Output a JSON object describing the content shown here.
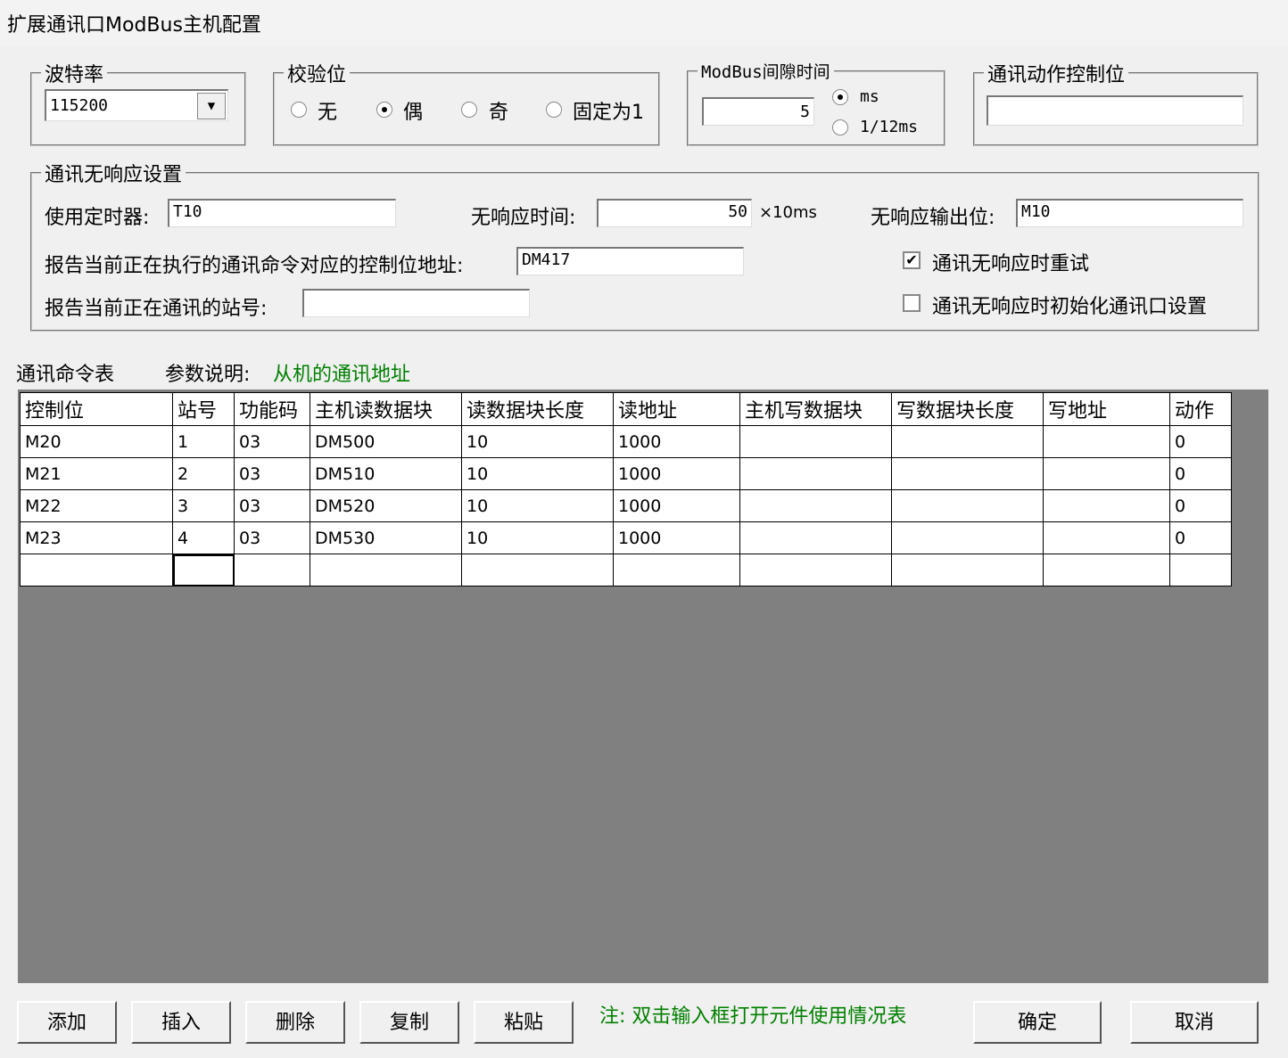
{
  "window": {
    "title": "扩展通讯口ModBus主机配置"
  },
  "baud": {
    "legend": "波特率",
    "value": "115200"
  },
  "parity": {
    "legend": "校验位",
    "options": [
      {
        "label": "无",
        "selected": false
      },
      {
        "label": "偶",
        "selected": true
      },
      {
        "label": "奇",
        "selected": false
      },
      {
        "label": "固定为1",
        "selected": false
      }
    ]
  },
  "gap": {
    "legend": "ModBus间隙时间",
    "value": "5",
    "units": [
      {
        "label": "ms",
        "selected": true
      },
      {
        "label": "1/12ms",
        "selected": false
      }
    ]
  },
  "action_ctrl": {
    "legend": "通讯动作控制位",
    "value": ""
  },
  "noresp": {
    "legend": "通讯无响应设置",
    "timer_label": "使用定时器:",
    "timer_value": "T10",
    "time_label": "无响应时间:",
    "time_value": "50",
    "time_unit": "×10ms",
    "out_label": "无响应输出位:",
    "out_value": "M10",
    "report_ctrl_label": "报告当前正在执行的通讯命令对应的控制位地址:",
    "report_ctrl_value": "DM417",
    "report_station_label": "报告当前正在通讯的站号:",
    "report_station_value": "",
    "retry_label": "通讯无响应时重试",
    "retry_checked": true,
    "reinit_label": "通讯无响应时初始化通讯口设置",
    "reinit_checked": false
  },
  "cmd": {
    "title": "通讯命令表",
    "param_label": "参数说明:",
    "param_value": "从机的通讯地址",
    "columns": [
      "控制位",
      "站号",
      "功能码",
      "主机读数据块",
      "读数据块长度",
      "读地址",
      "主机写数据块",
      "写数据块长度",
      "写地址",
      "动作"
    ],
    "rows": [
      [
        "M20",
        "1",
        "03",
        "DM500",
        "10",
        "1000",
        "",
        "",
        "",
        "0"
      ],
      [
        "M21",
        "2",
        "03",
        "DM510",
        "10",
        "1000",
        "",
        "",
        "",
        "0"
      ],
      [
        "M22",
        "3",
        "03",
        "DM520",
        "10",
        "1000",
        "",
        "",
        "",
        "0"
      ],
      [
        "M23",
        "4",
        "03",
        "DM530",
        "10",
        "1000",
        "",
        "",
        "",
        "0"
      ],
      [
        "",
        "",
        "",
        "",
        "",
        "",
        "",
        "",
        "",
        ""
      ]
    ]
  },
  "buttons": {
    "add": "添加",
    "insert": "插入",
    "delete": "删除",
    "copy": "复制",
    "paste": "粘贴",
    "ok": "确定",
    "cancel": "取消"
  },
  "note": "注: 双击输入框打开元件使用情况表"
}
